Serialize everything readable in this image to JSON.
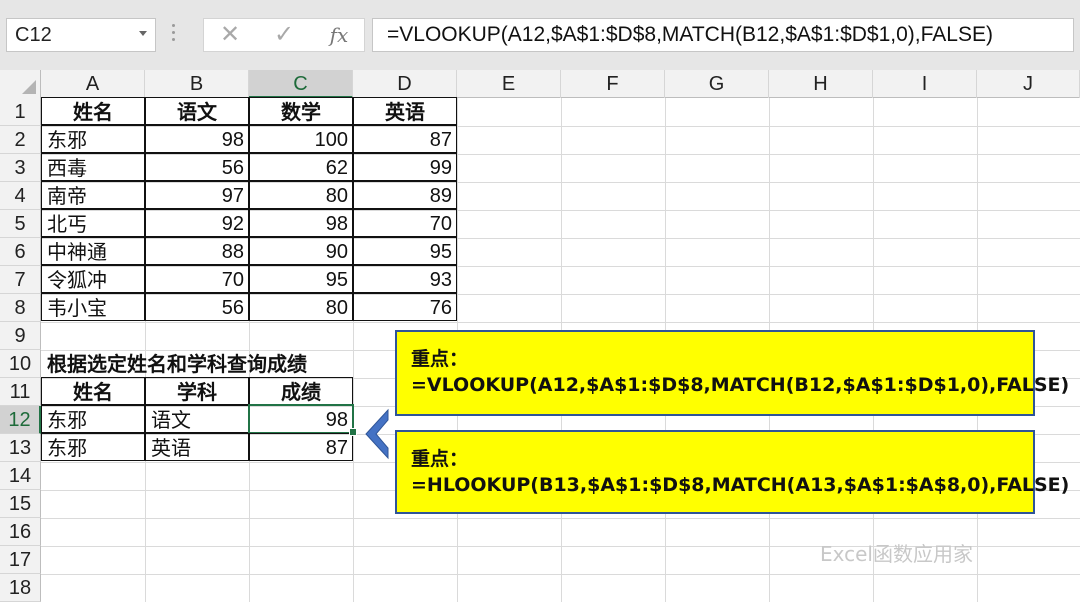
{
  "formula_bar": {
    "name_box": "C12",
    "cancel_icon": "✕",
    "enter_icon": "✓",
    "fx_label": "fx",
    "formula": "=VLOOKUP(A12,$A$1:$D$8,MATCH(B12,$A$1:$D$1,0),FALSE)"
  },
  "columns": [
    "A",
    "B",
    "C",
    "D",
    "E",
    "F",
    "G",
    "H",
    "I",
    "J"
  ],
  "rows": [
    "1",
    "2",
    "3",
    "4",
    "5",
    "6",
    "7",
    "8",
    "9",
    "10",
    "11",
    "12",
    "13",
    "14",
    "15",
    "16",
    "17",
    "18"
  ],
  "table": {
    "headers": [
      "姓名",
      "语文",
      "数学",
      "英语"
    ],
    "rows": [
      {
        "name": "东邪",
        "chinese": "98",
        "math": "100",
        "english": "87"
      },
      {
        "name": "西毒",
        "chinese": "56",
        "math": "62",
        "english": "99"
      },
      {
        "name": "南帝",
        "chinese": "97",
        "math": "80",
        "english": "89"
      },
      {
        "name": "北丐",
        "chinese": "92",
        "math": "98",
        "english": "70"
      },
      {
        "name": "中神通",
        "chinese": "88",
        "math": "90",
        "english": "95"
      },
      {
        "name": "令狐冲",
        "chinese": "70",
        "math": "95",
        "english": "93"
      },
      {
        "name": "韦小宝",
        "chinese": "56",
        "math": "80",
        "english": "76"
      }
    ]
  },
  "lookup": {
    "title": "根据选定姓名和学科查询成绩",
    "headers": [
      "姓名",
      "学科",
      "成绩"
    ],
    "rows": [
      {
        "name": "东邪",
        "subject": "语文",
        "score": "98"
      },
      {
        "name": "东邪",
        "subject": "英语",
        "score": "87"
      }
    ]
  },
  "callouts": [
    {
      "title": "重点：",
      "formula": "=VLOOKUP(A12,$A$1:$D$8,MATCH(B12,$A$1:$D$1,0),FALSE)"
    },
    {
      "title": "重点：",
      "formula": "=HLOOKUP(B13,$A$1:$D$8,MATCH(A13,$A$1:$A$8,0),FALSE)"
    }
  ],
  "watermark": "Excel函数应用家",
  "colors": {
    "accent": "#217346",
    "callout_bg": "#ffff00",
    "callout_border": "#2f5597",
    "arrow": "#4472c4"
  },
  "selection": {
    "active_cell": "C12",
    "active_column": "C",
    "active_row": "12"
  }
}
